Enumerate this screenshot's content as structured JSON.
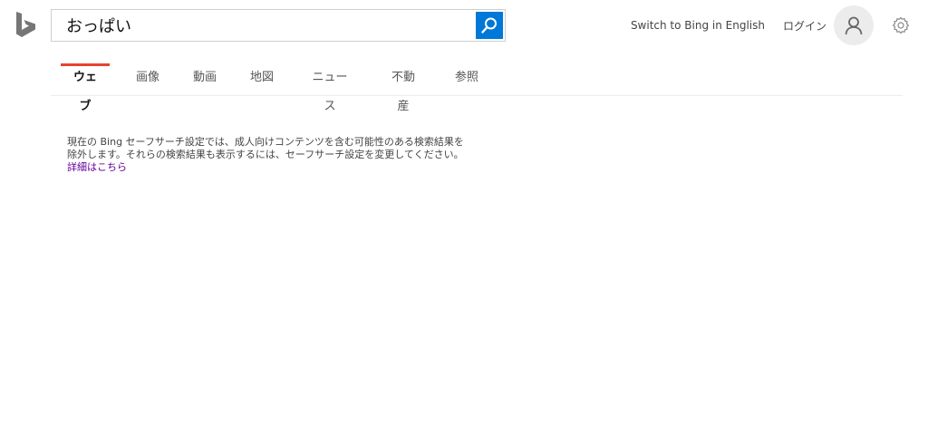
{
  "brand": {
    "logo_icon": "bing-logo-icon",
    "accent_color": "#e8422f",
    "search_button_color": "#0078d7"
  },
  "search": {
    "query": "おっぱい",
    "button_icon": "search-icon"
  },
  "header": {
    "switch_language_label": "Switch to Bing in English",
    "login_label": "ログイン",
    "avatar_icon": "user-icon",
    "settings_icon": "gear-icon"
  },
  "nav": {
    "tabs": [
      {
        "label": "ウェブ",
        "active": true
      },
      {
        "label": "画像"
      },
      {
        "label": "動画"
      },
      {
        "label": "地図"
      },
      {
        "label": "ニュース"
      },
      {
        "label": "不動産"
      },
      {
        "label": "参照"
      }
    ]
  },
  "notice": {
    "line1": "現在の Bing セーフサーチ設定では、成人向けコンテンツを含む可能性のある検索結果を",
    "line2": "除外します。それらの検索結果も表示するには、セーフサーチ設定を変更してください。",
    "link_label": "詳細はこちら"
  }
}
